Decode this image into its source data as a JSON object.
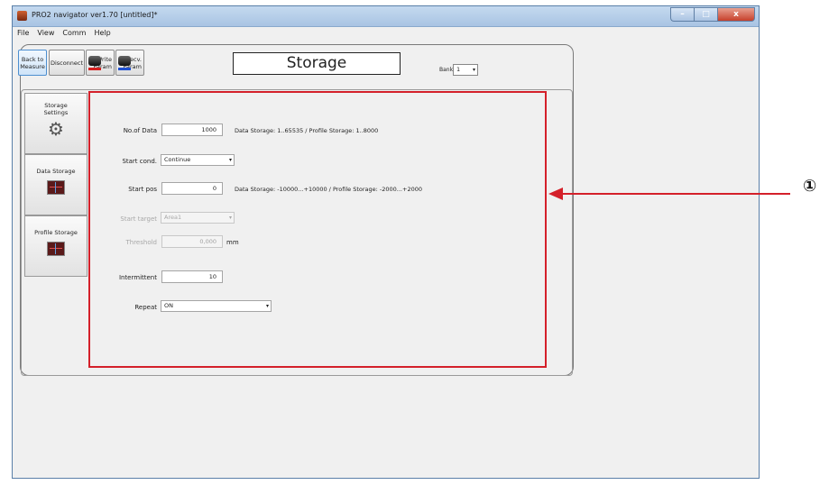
{
  "window": {
    "title": "PRO2 navigator ver1.70 [untitled]*",
    "controls": {
      "minimize": "–",
      "maximize": "□",
      "close": "x"
    }
  },
  "menu": [
    "File",
    "View",
    "Comm",
    "Help"
  ],
  "toolbar": {
    "back_line1": "Back to",
    "back_line2": "Measure",
    "disconnect": "Disconnect",
    "write_line1": "Write",
    "write_line2": "Param",
    "recv_line1": "Recv.",
    "recv_line2": "Param"
  },
  "page_title": "Storage",
  "bank": {
    "label": "Bank",
    "value": "1",
    "arrow": "▾"
  },
  "side_tabs": [
    {
      "line1": "Storage",
      "line2": "Settings",
      "icon": "gear-icon"
    },
    {
      "line1": "Data Storage",
      "icon": "chart-icon"
    },
    {
      "line1": "Profile Storage",
      "icon": "chart-icon"
    }
  ],
  "form": {
    "no_of_data": {
      "label": "No.of Data",
      "value": "1000",
      "hint": "Data Storage: 1..65535 / Profile Storage: 1..8000"
    },
    "start_cond": {
      "label": "Start cond.",
      "value": "Continue",
      "arrow": "▾"
    },
    "start_pos": {
      "label": "Start pos",
      "value": "0",
      "hint": "Data Storage: -10000...+10000 / Profile Storage: -2000...+2000"
    },
    "start_target": {
      "label": "Start target",
      "value": "Area1",
      "arrow": "▾"
    },
    "threshold": {
      "label": "Threshold",
      "value": "0,000",
      "unit": "mm"
    },
    "intermittent": {
      "label": "Intermittent",
      "value": "10"
    },
    "repeat": {
      "label": "Repeat",
      "value": "ON",
      "arrow": "▾"
    }
  },
  "callout": {
    "number": "①",
    "color": "#d4202a"
  }
}
